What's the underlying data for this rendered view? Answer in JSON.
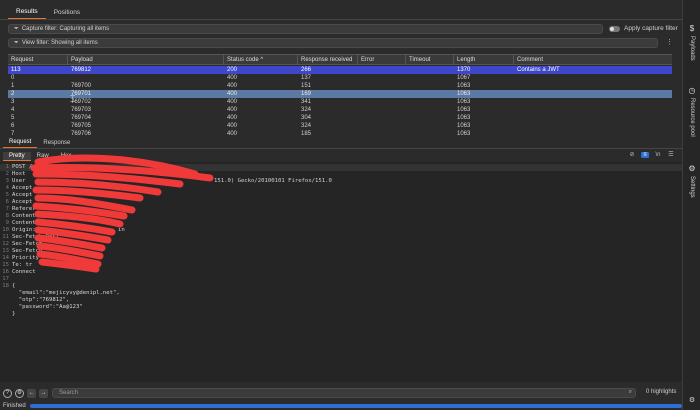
{
  "tabs": [
    "Results",
    "Positions"
  ],
  "capture_filter": {
    "icon": "funnel-icon",
    "text": "Capture filter: Capturing all items",
    "toggle_label": "Apply capture filter"
  },
  "view_filter": {
    "icon": "funnel-icon",
    "text": "View filter: Showing all items",
    "menu_icon": "kebab-icon"
  },
  "table": {
    "columns": [
      "Request",
      "Payload",
      "Status code",
      "Response received",
      "Error",
      "Timeout",
      "Length",
      "Comment"
    ],
    "sort_indicator": "^",
    "rows": [
      [
        "113",
        "769812",
        "200",
        "266",
        "",
        "",
        "1370",
        "Contains a JWT"
      ],
      [
        "0",
        "",
        "400",
        "137",
        "",
        "",
        "1067",
        ""
      ],
      [
        "1",
        "769700",
        "400",
        "151",
        "",
        "",
        "1063",
        ""
      ],
      [
        "2",
        "769701",
        "400",
        "169",
        "",
        "",
        "1063",
        ""
      ],
      [
        "3",
        "769702",
        "400",
        "341",
        "",
        "",
        "1063",
        ""
      ],
      [
        "4",
        "769703",
        "400",
        "324",
        "",
        "",
        "1063",
        ""
      ],
      [
        "5",
        "769704",
        "400",
        "304",
        "",
        "",
        "1063",
        ""
      ],
      [
        "6",
        "769705",
        "400",
        "324",
        "",
        "",
        "1063",
        ""
      ],
      [
        "7",
        "769706",
        "400",
        "185",
        "",
        "",
        "1063",
        ""
      ]
    ]
  },
  "request_response_tabs": [
    "Request",
    "Response"
  ],
  "view_tabs": [
    "Pretty",
    "Raw",
    "Hex"
  ],
  "editor_tools": [
    "eye-slash-icon",
    "list-icon",
    "newline-icon",
    "menu-icon"
  ],
  "code_lines": [
    {
      "n": "1",
      "t": "POST /"
    },
    {
      "n": "2",
      "t": "Host"
    },
    {
      "n": "3",
      "t": "User"
    },
    {
      "n": "4",
      "t": "Accept"
    },
    {
      "n": "5",
      "t": "Accept"
    },
    {
      "n": "6",
      "t": "Accept"
    },
    {
      "n": "7",
      "t": "Referer"
    },
    {
      "n": "8",
      "t": "Content-Type"
    },
    {
      "n": "9",
      "t": "Content-L"
    },
    {
      "n": "10",
      "t": "Origin:"
    },
    {
      "n": "11",
      "t": "Sec-Fetch-Dest"
    },
    {
      "n": "12",
      "t": "Sec-Fetch"
    },
    {
      "n": "13",
      "t": "Sec-Fetch"
    },
    {
      "n": "14",
      "t": "Priority"
    },
    {
      "n": "15",
      "t": "Te: tr"
    },
    {
      "n": "16",
      "t": "Connect"
    },
    {
      "n": "17",
      "t": ""
    },
    {
      "n": "18",
      "t": "{"
    },
    {
      "n": "",
      "t": "  \"email\":\"mejicyvy@denipl.net\","
    },
    {
      "n": "",
      "t": "  \"otp\":\"769812\","
    },
    {
      "n": "",
      "t": "  \"password\":\"Aa@123\""
    },
    {
      "n": "",
      "t": "}"
    }
  ],
  "user_agent_tail": "151.0) Gecko/20100101 Firefox/151.0",
  "origin_tail": "in",
  "search": {
    "placeholder": "Search",
    "highlights": "0 highlights"
  },
  "status": {
    "text": "Finished",
    "progress": 1.0
  },
  "sidebar": [
    {
      "icon": "dollar-icon",
      "label": "Payloads"
    },
    {
      "icon": "clock-icon",
      "label": "Resource pool"
    },
    {
      "icon": "gear-icon",
      "label": "Settings"
    }
  ],
  "colors": {
    "accent": "#e5762b",
    "selected_row": "#3e46c9",
    "secondary_row": "#5b79a3",
    "scribble": "#f03a3a",
    "progress": "#2e6fd1"
  }
}
